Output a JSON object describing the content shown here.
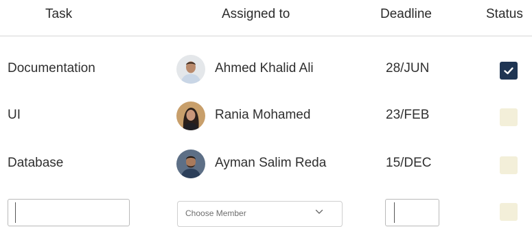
{
  "table": {
    "headers": {
      "task": "Task",
      "assigned_to": "Assigned to",
      "deadline": "Deadline",
      "status": "Status"
    },
    "rows": [
      {
        "task": "Documentation",
        "member": "Ahmed Khalid Ali",
        "deadline": "28/JUN",
        "status_checked": true,
        "avatar_icon": "avatar-man-light-shirt-icon"
      },
      {
        "task": "UI",
        "member": "Rania Mohamed",
        "deadline": "23/FEB",
        "status_checked": false,
        "avatar_icon": "avatar-woman-icon"
      },
      {
        "task": "Database",
        "member": "Ayman Salim Reda",
        "deadline": "15/DEC",
        "status_checked": false,
        "avatar_icon": "avatar-man-icon"
      }
    ],
    "new_row": {
      "task_value": "",
      "member_placeholder": "Choose Member",
      "deadline_value": "",
      "status_checked": false
    }
  },
  "colors": {
    "checked_box": "#1f3553",
    "unchecked_box": "#f3efd9",
    "divider": "#d6d6d6",
    "text": "#2f2f2f"
  }
}
